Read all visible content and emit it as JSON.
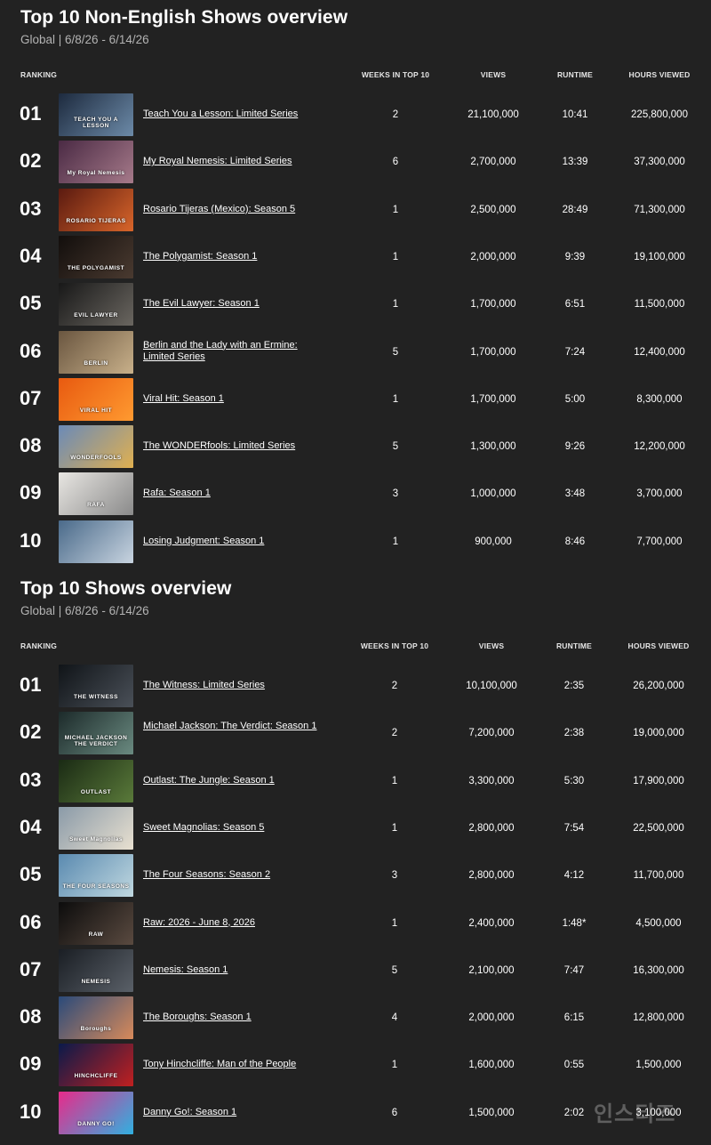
{
  "columns": {
    "ranking": "RANKING",
    "weeks": "WEEKS IN TOP 10",
    "views": "VIEWS",
    "runtime": "RUNTIME",
    "hours": "HOURS VIEWED"
  },
  "non_english": {
    "title": "Top 10 Non-English Shows overview",
    "subtitle": "Global | 6/8/26 - 6/14/26",
    "rows": [
      {
        "rank": "01",
        "title": "Teach You a Lesson: Limited Series",
        "weeks": "2",
        "views": "21,100,000",
        "runtime": "10:41",
        "hours": "225,800,000",
        "poster": "TEACH YOU A LESSON",
        "colors": [
          "#1d2a3e",
          "#6c8aa8"
        ]
      },
      {
        "rank": "02",
        "title": "My Royal Nemesis: Limited Series",
        "weeks": "6",
        "views": "2,700,000",
        "runtime": "13:39",
        "hours": "37,300,000",
        "poster": "My Royal Nemesis",
        "colors": [
          "#4a2a44",
          "#a67a8a"
        ]
      },
      {
        "rank": "03",
        "title": "Rosario Tijeras (Mexico): Season 5",
        "weeks": "1",
        "views": "2,500,000",
        "runtime": "28:49",
        "hours": "71,300,000",
        "poster": "ROSARIO TIJERAS",
        "colors": [
          "#5a1a10",
          "#d8652a"
        ]
      },
      {
        "rank": "04",
        "title": "The Polygamist: Season 1",
        "weeks": "1",
        "views": "2,000,000",
        "runtime": "9:39",
        "hours": "19,100,000",
        "poster": "THE POLYGAMIST",
        "colors": [
          "#120e0c",
          "#4a3a30"
        ]
      },
      {
        "rank": "05",
        "title": "The Evil Lawyer: Season 1",
        "weeks": "1",
        "views": "1,700,000",
        "runtime": "6:51",
        "hours": "11,500,000",
        "poster": "EVIL LAWYER",
        "colors": [
          "#181818",
          "#6a6660"
        ]
      },
      {
        "rank": "06",
        "title": "Berlin and the Lady with an Ermine: Limited Series",
        "weeks": "5",
        "views": "1,700,000",
        "runtime": "7:24",
        "hours": "12,400,000",
        "poster": "BERLIN",
        "colors": [
          "#6a5640",
          "#c8b08a"
        ]
      },
      {
        "rank": "07",
        "title": "Viral Hit: Season 1",
        "weeks": "1",
        "views": "1,700,000",
        "runtime": "5:00",
        "hours": "8,300,000",
        "poster": "VIRAL HIT",
        "colors": [
          "#e85a10",
          "#ff9a30"
        ]
      },
      {
        "rank": "08",
        "title": "The WONDERfools: Limited Series",
        "weeks": "5",
        "views": "1,300,000",
        "runtime": "9:26",
        "hours": "12,200,000",
        "poster": "WONDERFOOLS",
        "colors": [
          "#6a8ab8",
          "#e0b050"
        ]
      },
      {
        "rank": "09",
        "title": "Rafa: Season 1",
        "weeks": "3",
        "views": "1,000,000",
        "runtime": "3:48",
        "hours": "3,700,000",
        "poster": "RAFA",
        "colors": [
          "#e8e6e2",
          "#8a8a8a"
        ]
      },
      {
        "rank": "10",
        "title": "Losing Judgment: Season 1",
        "weeks": "1",
        "views": "900,000",
        "runtime": "8:46",
        "hours": "7,700,000",
        "poster": "",
        "colors": [
          "#4a6a8a",
          "#c8d4e0"
        ]
      }
    ]
  },
  "shows": {
    "title": "Top 10 Shows overview",
    "subtitle": "Global | 6/8/26 - 6/14/26",
    "rows": [
      {
        "rank": "01",
        "title": "The Witness: Limited Series",
        "weeks": "2",
        "views": "10,100,000",
        "runtime": "2:35",
        "hours": "26,200,000",
        "poster": "THE WITNESS",
        "colors": [
          "#101418",
          "#4a5058"
        ]
      },
      {
        "rank": "02",
        "title": "Michael Jackson: The Verdict: Season 1",
        "weeks": "2",
        "views": "7,200,000",
        "runtime": "2:38",
        "hours": "19,000,000",
        "poster": "MICHAEL JACKSON THE VERDICT",
        "colors": [
          "#1c2a2a",
          "#6a8a80"
        ]
      },
      {
        "rank": "03",
        "title": "Outlast: The Jungle: Season 1",
        "weeks": "1",
        "views": "3,300,000",
        "runtime": "5:30",
        "hours": "17,900,000",
        "poster": "OUTLAST",
        "colors": [
          "#1a2a14",
          "#5a7a3a"
        ]
      },
      {
        "rank": "04",
        "title": "Sweet Magnolias: Season 5",
        "weeks": "1",
        "views": "2,800,000",
        "runtime": "7:54",
        "hours": "22,500,000",
        "poster": "Sweet Magnolias",
        "colors": [
          "#8a9aa8",
          "#e8e0d0"
        ]
      },
      {
        "rank": "05",
        "title": "The Four Seasons: Season 2",
        "weeks": "3",
        "views": "2,800,000",
        "runtime": "4:12",
        "hours": "11,700,000",
        "poster": "THE FOUR SEASONS",
        "colors": [
          "#5a8ab0",
          "#c0d8e0"
        ]
      },
      {
        "rank": "06",
        "title": "Raw: 2026 - June 8, 2026",
        "weeks": "1",
        "views": "2,400,000",
        "runtime": "1:48*",
        "hours": "4,500,000",
        "poster": "RAW",
        "colors": [
          "#0c0c0c",
          "#5a4a40"
        ]
      },
      {
        "rank": "07",
        "title": "Nemesis: Season 1",
        "weeks": "5",
        "views": "2,100,000",
        "runtime": "7:47",
        "hours": "16,300,000",
        "poster": "NEMESIS",
        "colors": [
          "#1a1e24",
          "#5a6068"
        ]
      },
      {
        "rank": "08",
        "title": "The Boroughs: Season 1",
        "weeks": "4",
        "views": "2,000,000",
        "runtime": "6:15",
        "hours": "12,800,000",
        "poster": "Boroughs",
        "colors": [
          "#2a4a7a",
          "#d88a5a"
        ]
      },
      {
        "rank": "09",
        "title": "Tony Hinchcliffe: Man of the People",
        "weeks": "1",
        "views": "1,600,000",
        "runtime": "0:55",
        "hours": "1,500,000",
        "poster": "HINCHCLIFFE",
        "colors": [
          "#0a1a4a",
          "#c02020"
        ]
      },
      {
        "rank": "10",
        "title": "Danny Go!: Season 1",
        "weeks": "6",
        "views": "1,500,000",
        "runtime": "2:02",
        "hours": "3,100,000",
        "poster": "DANNY GO!",
        "colors": [
          "#e82a8a",
          "#30b0e0"
        ]
      }
    ]
  },
  "watermark": "인스티즈"
}
